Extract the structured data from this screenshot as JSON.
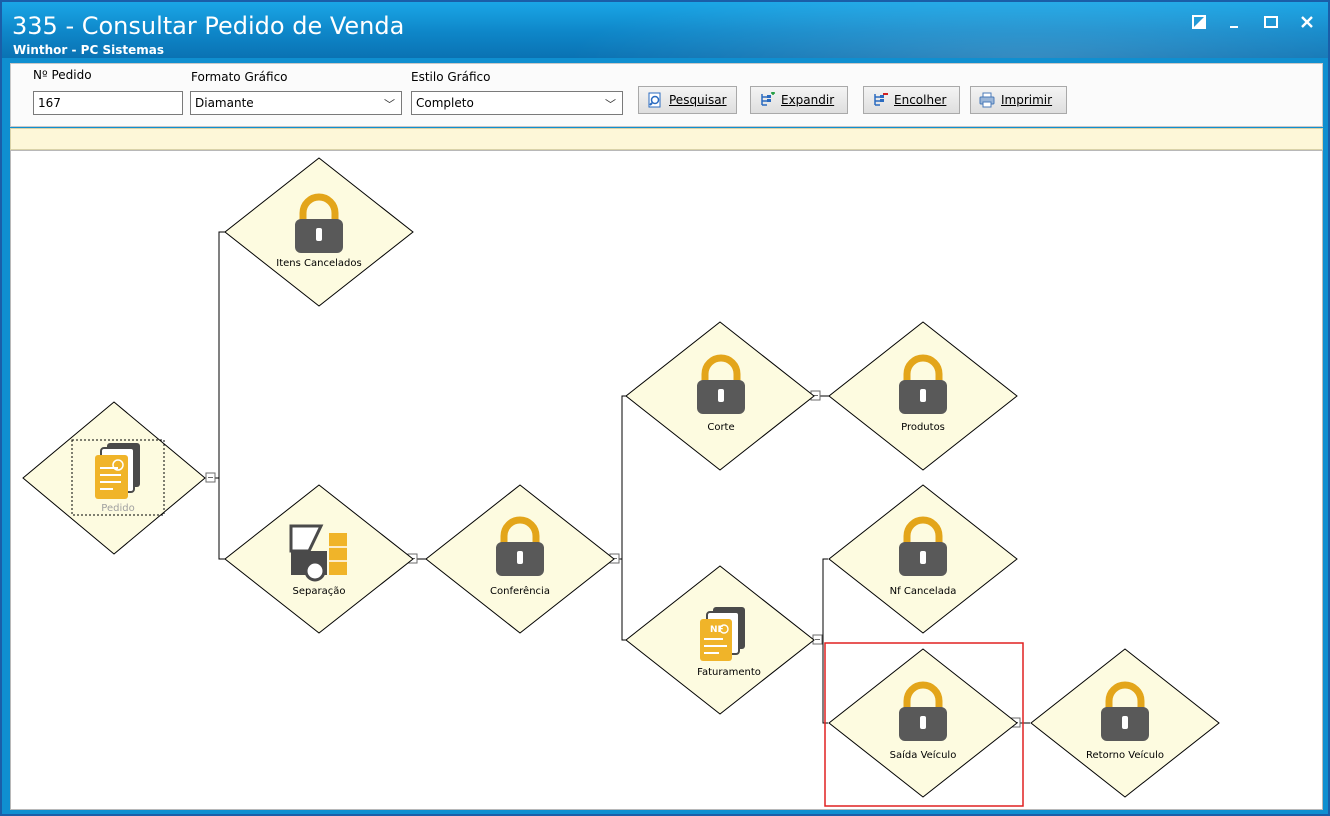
{
  "window": {
    "title": "335 - Consultar Pedido de Venda",
    "subtitle": "Winthor - PC Sistemas",
    "controls": [
      "restore-icon",
      "minimize-icon",
      "maximize-icon",
      "close-icon"
    ]
  },
  "toolbar": {
    "pedido_label": "Nº Pedido",
    "pedido_value": "167",
    "formato_label": "Formato Gráfico",
    "formato_value": "Diamante",
    "estilo_label": "Estilo Gráfico",
    "estilo_value": "Completo",
    "buttons": {
      "pesquisar": {
        "label": "Pesquisar",
        "icon": "search-doc-icon"
      },
      "expandir": {
        "label": "Expandir",
        "icon": "tree-expand-icon"
      },
      "encolher": {
        "label": "Encolher",
        "icon": "tree-collapse-icon"
      },
      "imprimir": {
        "label": "Imprimir",
        "icon": "printer-icon"
      }
    }
  },
  "diagram": {
    "nodes": {
      "pedido": {
        "label": "Pedido",
        "icon": "document-stack-icon",
        "state": "selected"
      },
      "itens_cancelados": {
        "label": "Itens Cancelados",
        "icon": "lock-icon"
      },
      "separacao": {
        "label": "Separação",
        "icon": "forklift-icon"
      },
      "conferencia": {
        "label": "Conferência",
        "icon": "lock-icon"
      },
      "corte": {
        "label": "Corte",
        "icon": "lock-icon"
      },
      "produtos": {
        "label": "Produtos",
        "icon": "lock-icon"
      },
      "faturamento": {
        "label": "Faturamento",
        "icon": "invoice-nf-icon"
      },
      "nf_cancelada": {
        "label": "Nf Cancelada",
        "icon": "lock-icon"
      },
      "saida_veiculo": {
        "label": "Saída Veículo",
        "icon": "lock-icon",
        "highlighted": true
      },
      "retorno_veiculo": {
        "label": "Retorno Veículo",
        "icon": "lock-icon"
      }
    },
    "nf_badge": "NF",
    "colors": {
      "diamond_fill": "#fdfbe0",
      "lock_shackle": "#e3a51a",
      "lock_body": "#595959",
      "highlight": "#e02020"
    }
  }
}
